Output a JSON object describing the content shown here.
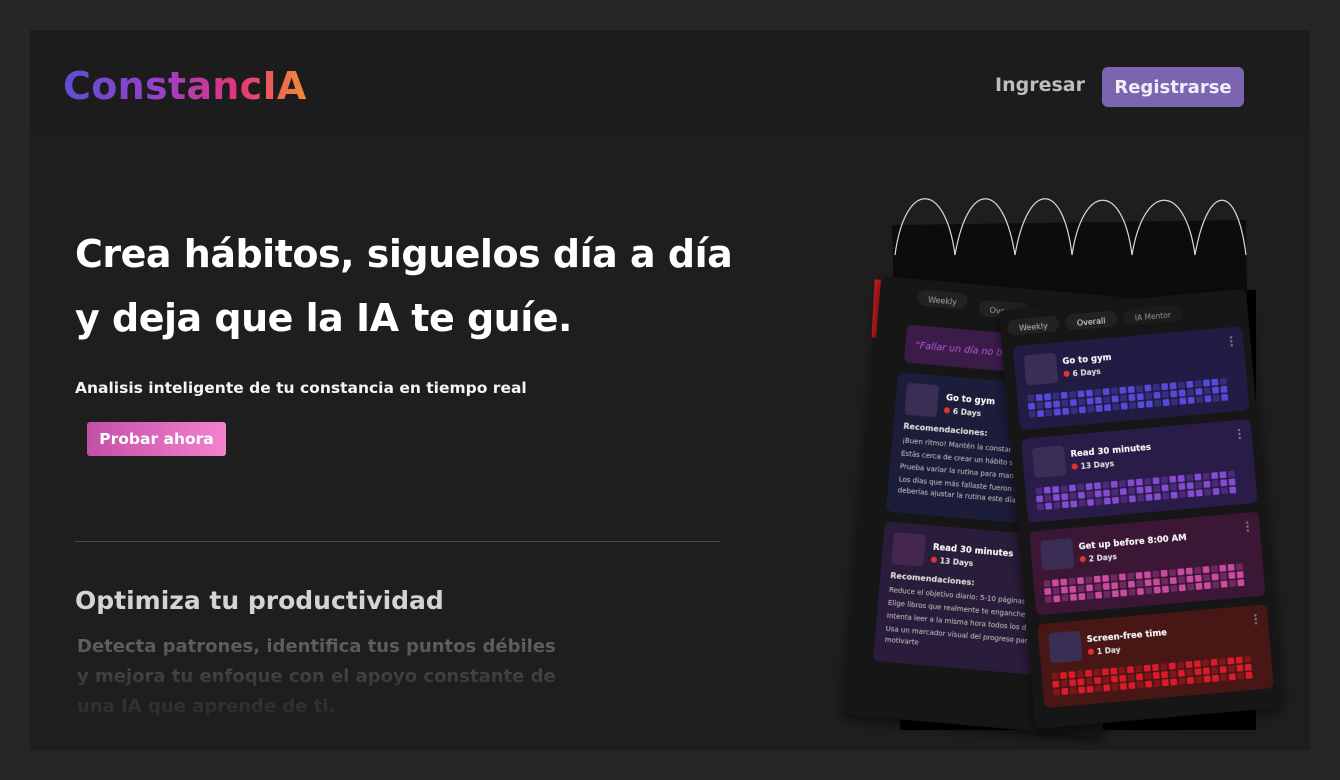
{
  "brand": {
    "name": "ConstancIA"
  },
  "nav": {
    "login_label": "Ingresar",
    "register_label": "Registrarse"
  },
  "hero": {
    "title_line1": "Crea hábitos, siguelos día a día",
    "title_line2": "y deja que la IA te guíe.",
    "subtitle": "Analisis inteligente de tu constancia en tiempo real",
    "cta_label": "Probar ahora"
  },
  "feature": {
    "title": "Optimiza tu productividad",
    "desc_line1": "Detecta patrones, identifica tus puntos débiles",
    "desc_line2": "y mejora tu enfoque con el apoyo constante de",
    "desc_line3": "una IA que aprende de ti."
  },
  "mockup": {
    "back": {
      "tabs": [
        "Weekly",
        "Overall"
      ],
      "quote": "\"Fallar un día no borra tu",
      "card1": {
        "name": "Go to gym",
        "days": "6 Days",
        "rec_title": "Recomendaciones:",
        "recs": [
          "¡Buen ritmo! Mantén la constancia.",
          "Estás cerca de crear un hábito sólido, sig",
          "Prueba variar la rutina para mantener la m",
          "Los días que más fallaste fueron los mier",
          "deberías ajustar la rutina este día"
        ]
      },
      "card2": {
        "name": "Read 30 minutes",
        "days": "13 Days",
        "rec_title": "Recomendaciones:",
        "recs": [
          "Reduce el objetivo diario: 5-10 páginas es suficiente",
          "Elige libros que realmente te enganchen.",
          "Intenta leer a la misma hora todos los días",
          "Usa un marcador visual del progreso para",
          "motivarte"
        ]
      }
    },
    "front": {
      "tabs": [
        "Weekly",
        "Overall",
        "IA Mentor"
      ],
      "habits": [
        {
          "name": "Go to gym",
          "days": "6 Days",
          "color": "#5b4fe0"
        },
        {
          "name": "Read 30 minutes",
          "days": "13 Days",
          "color": "#8a4fd8"
        },
        {
          "name": "Get up before 8:00 AM",
          "days": "2 Days",
          "color": "#d24fa8"
        },
        {
          "name": "Screen-free time",
          "days": "1 Day",
          "color": "#e0202a"
        }
      ]
    }
  }
}
